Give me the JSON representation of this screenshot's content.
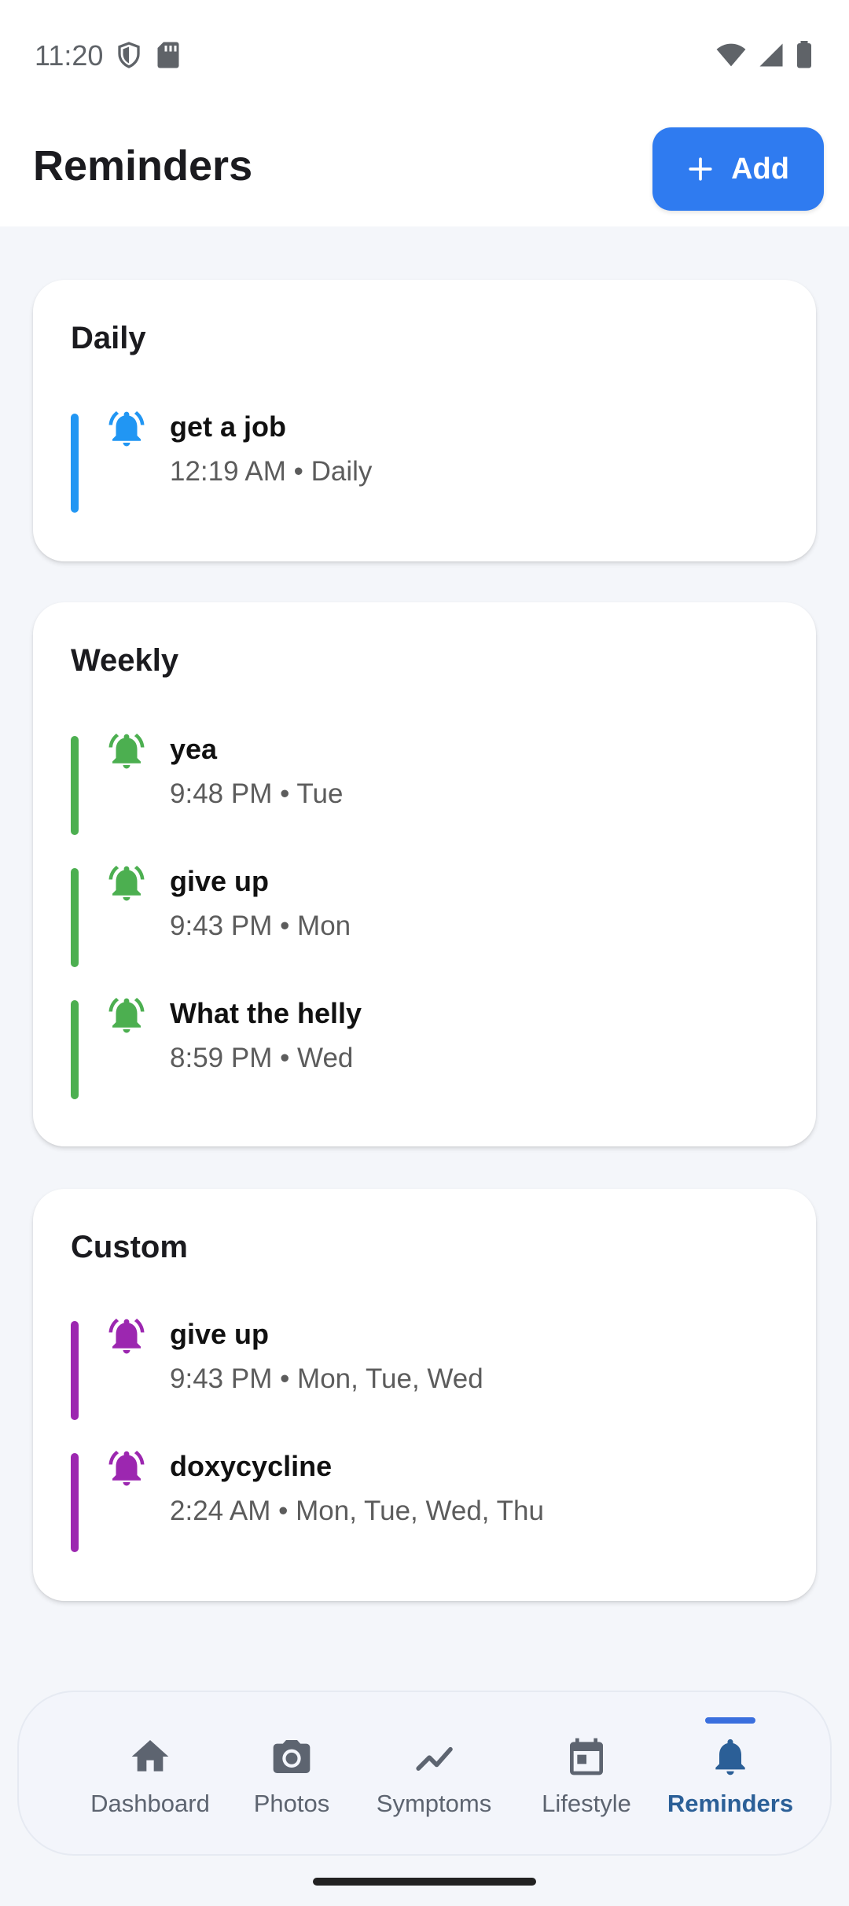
{
  "status_bar": {
    "time": "11:20",
    "icons_left": [
      "shield-icon",
      "sd-card-icon"
    ],
    "icons_right": [
      "wifi-icon",
      "cell-signal-icon",
      "battery-icon"
    ]
  },
  "header": {
    "title": "Reminders",
    "add_button": {
      "label": "Add",
      "icon": "plus-icon"
    }
  },
  "colors": {
    "daily": "#2196F3",
    "weekly": "#4CAF50",
    "custom": "#9C27B0",
    "accent": "#2F7BF0",
    "nav_active": "#2B5F97"
  },
  "sections": {
    "daily": {
      "title": "Daily",
      "items": [
        {
          "title": "get a job",
          "subtitle": "12:19 AM • Daily"
        }
      ]
    },
    "weekly": {
      "title": "Weekly",
      "items": [
        {
          "title": "yea",
          "subtitle": "9:48 PM • Tue"
        },
        {
          "title": "give up",
          "subtitle": "9:43 PM • Mon"
        },
        {
          "title": "What the helly",
          "subtitle": "8:59 PM • Wed"
        }
      ]
    },
    "custom": {
      "title": "Custom",
      "items": [
        {
          "title": "give up",
          "subtitle": "9:43 PM • Mon, Tue, Wed"
        },
        {
          "title": "doxycycline",
          "subtitle": "2:24 AM • Mon, Tue, Wed, Thu"
        }
      ]
    }
  },
  "bottom_nav": {
    "items": [
      {
        "label": "Dashboard",
        "icon": "home-icon"
      },
      {
        "label": "Photos",
        "icon": "camera-icon"
      },
      {
        "label": "Symptoms",
        "icon": "trend-icon"
      },
      {
        "label": "Lifestyle",
        "icon": "calendar-icon"
      },
      {
        "label": "Reminders",
        "icon": "bell-icon",
        "active": true
      }
    ]
  }
}
